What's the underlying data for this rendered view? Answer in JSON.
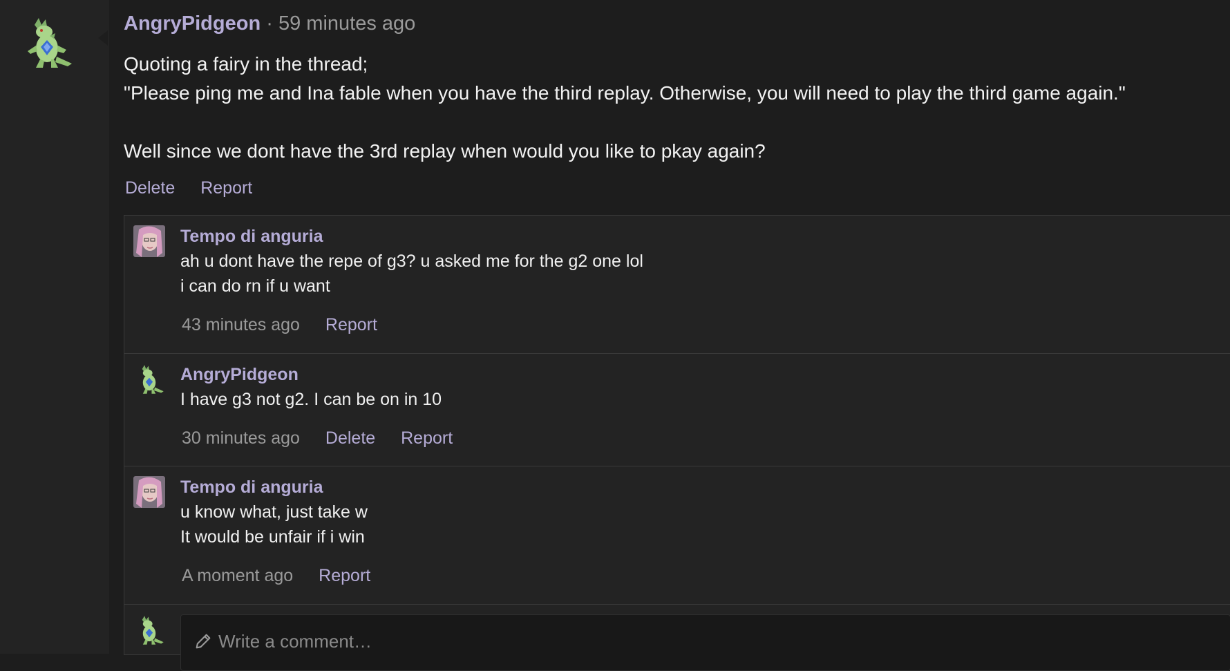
{
  "post": {
    "author": "AngryPidgeon",
    "separator": "·",
    "time": "59 minutes ago",
    "body": [
      "Quoting a fairy in the thread;",
      "\"Please ping me and Ina fable when you have the third replay. Otherwise, you will need to play the third game again.\"",
      "",
      "Well since we dont have the 3rd replay when would you like to pkay again?"
    ],
    "actions": {
      "delete": "Delete",
      "report": "Report"
    }
  },
  "replies": [
    {
      "author": "Tempo di anguria",
      "lines": [
        "ah u dont have the repe of g3? u asked me for the g2 one lol",
        "i can do rn if u want"
      ],
      "time": "43 minutes ago",
      "actions": [
        "Report"
      ]
    },
    {
      "author": "AngryPidgeon",
      "lines": [
        "I have g3 not g2. I can be on in 10"
      ],
      "time": "30 minutes ago",
      "actions": [
        "Delete",
        "Report"
      ]
    },
    {
      "author": "Tempo di anguria",
      "lines": [
        "u know what, just take w",
        "It would be unfair if i win"
      ],
      "time": "A moment ago",
      "actions": [
        "Report"
      ]
    }
  ],
  "composer": {
    "placeholder": "Write a comment…",
    "icon": "pencil-icon"
  },
  "colors": {
    "accent": "#b5acd6",
    "background": "#1d1d1d",
    "panel": "#232323"
  }
}
